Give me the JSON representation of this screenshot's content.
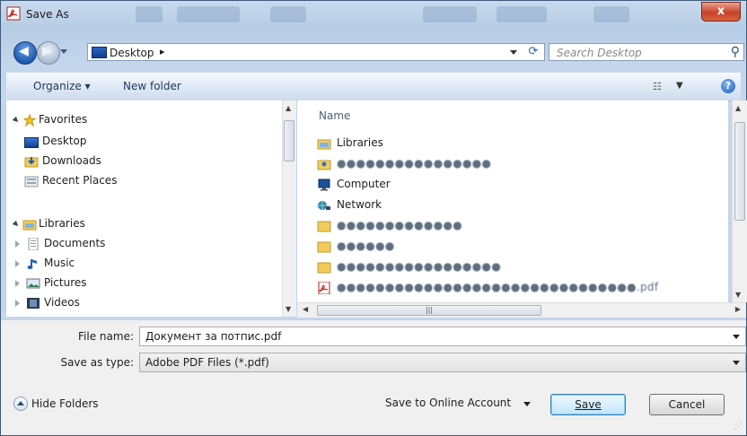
{
  "window": {
    "title": "Save As",
    "close_label": "x"
  },
  "address": {
    "location": "Desktop",
    "separator": "▸"
  },
  "search": {
    "placeholder": "Search Desktop"
  },
  "toolbar": {
    "organize": "Organize ▾",
    "new_folder": "New folder",
    "help": "?"
  },
  "nav": {
    "favorites_label": "Favorites",
    "favorites": [
      "Desktop",
      "Downloads",
      "Recent Places"
    ],
    "libraries_label": "Libraries",
    "libraries": [
      "Documents",
      "Music",
      "Pictures",
      "Videos"
    ]
  },
  "files": {
    "column_name": "Name",
    "items": [
      {
        "name": "Libraries",
        "icon": "library-folder-icon"
      },
      {
        "name": "●●●●●●●●●●●●●●●●",
        "icon": "user-folder-icon",
        "blurred": true
      },
      {
        "name": "Computer",
        "icon": "computer-icon"
      },
      {
        "name": "Network",
        "icon": "network-icon"
      },
      {
        "name": "●●●●●●●●●●●●●",
        "icon": "folder-icon",
        "blurred": true
      },
      {
        "name": "●●●●●●",
        "icon": "folder-icon",
        "blurred": true
      },
      {
        "name": "●●●●●●●●●●●●●●●●●",
        "icon": "folder-icon",
        "blurred": true
      },
      {
        "name": "●●●●●●●●●●●●●●●●●●●●●●●●●●●●●●●.pdf",
        "icon": "pdf-file-icon",
        "blurred": true
      }
    ]
  },
  "form": {
    "file_name_label": "File name:",
    "file_name_value": "Документ за потпис.pdf",
    "save_type_label": "Save as type:",
    "save_type_value": "Adobe PDF Files (*.pdf)"
  },
  "footer": {
    "hide_folders": "Hide Folders",
    "online_account": "Save to Online Account",
    "save": "Save",
    "cancel": "Cancel"
  },
  "colors": {
    "title_bg": "#c9daee",
    "toolbar_bg": "#dfe9f5",
    "close_red": "#c7432a",
    "primary_button": "#bee6fd"
  }
}
